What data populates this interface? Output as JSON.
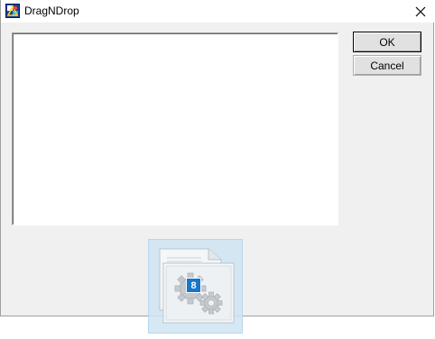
{
  "window": {
    "title": "DragNDrop",
    "app_icon": "dragndrop-app-icon",
    "close_icon": "close-icon"
  },
  "buttons": {
    "ok_label": "OK",
    "cancel_label": "Cancel"
  },
  "listbox": {
    "items": []
  },
  "drag_overlay": {
    "icon": "settings-files-icon",
    "item_count": "8"
  },
  "colors": {
    "dialog_background": "#f0f0f0",
    "badge_background": "#1776c9",
    "drag_highlight": "#cee4f2"
  }
}
